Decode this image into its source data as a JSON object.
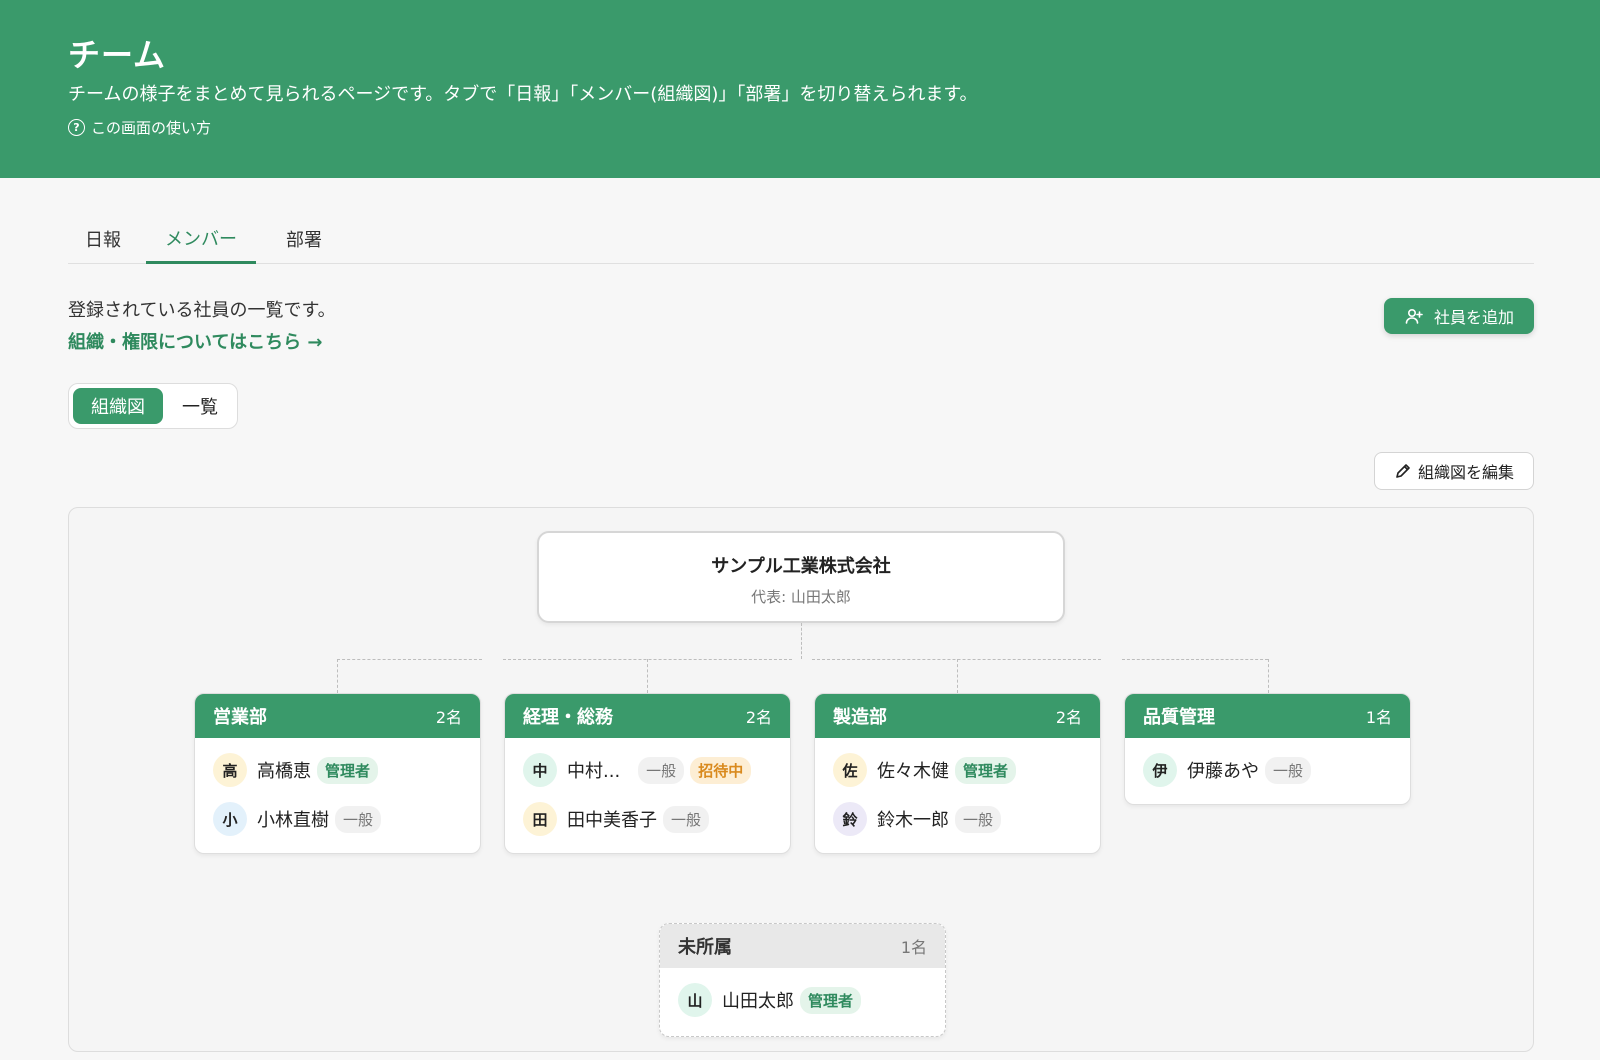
{
  "header": {
    "title": "チーム",
    "description": "チームの様子をまとめて見られるページです。タブで「日報」「メンバー(組織図)」「部署」を切り替えられます。",
    "help_label": "この画面の使い方",
    "help_icon": "question-circle-icon"
  },
  "tabs": [
    {
      "label": "日報",
      "active": false
    },
    {
      "label": "メンバー",
      "active": true
    },
    {
      "label": "部署",
      "active": false
    }
  ],
  "members_page": {
    "intro": "登録されている社員の一覧です。",
    "org_link": "組織・権限についてはこちら →",
    "add_button": "社員を追加",
    "view_toggle": [
      "組織図",
      "一覧"
    ],
    "view_selected": "組織図",
    "edit_button": "組織図を編集"
  },
  "company": {
    "name": "サンプル工業株式会社",
    "representative": "代表: 山田太郎"
  },
  "departments": [
    {
      "name": "営業部",
      "count": "2名",
      "members": [
        {
          "initial": "高",
          "name": "高橋恵",
          "badges": [
            {
              "text": "管理者",
              "kind": "admin"
            }
          ],
          "avatar_color": "#fdf3d6"
        },
        {
          "initial": "小",
          "name": "小林直樹",
          "badges": [
            {
              "text": "一般",
              "kind": "general"
            }
          ],
          "avatar_color": "#e3f1fb"
        }
      ]
    },
    {
      "name": "経理・総務",
      "count": "2名",
      "members": [
        {
          "initial": "中",
          "name": "中村...",
          "badges": [
            {
              "text": "一般",
              "kind": "general"
            },
            {
              "text": "招待中",
              "kind": "invite"
            }
          ],
          "avatar_color": "#e0f5ec"
        },
        {
          "initial": "田",
          "name": "田中美香子",
          "badges": [
            {
              "text": "一般",
              "kind": "general"
            }
          ],
          "avatar_color": "#fdf3d6"
        }
      ]
    },
    {
      "name": "製造部",
      "count": "2名",
      "members": [
        {
          "initial": "佐",
          "name": "佐々木健",
          "badges": [
            {
              "text": "管理者",
              "kind": "admin"
            }
          ],
          "avatar_color": "#fdf3d6"
        },
        {
          "initial": "鈴",
          "name": "鈴木一郎",
          "badges": [
            {
              "text": "一般",
              "kind": "general"
            }
          ],
          "avatar_color": "#ece9f7"
        }
      ]
    },
    {
      "name": "品質管理",
      "count": "1名",
      "members": [
        {
          "initial": "伊",
          "name": "伊藤あや",
          "badges": [
            {
              "text": "一般",
              "kind": "general"
            }
          ],
          "avatar_color": "#e0f5ec"
        }
      ]
    }
  ],
  "unassigned": {
    "name": "未所属",
    "count": "1名",
    "members": [
      {
        "initial": "山",
        "name": "山田太郎",
        "badges": [
          {
            "text": "管理者",
            "kind": "admin"
          }
        ],
        "avatar_color": "#e0f5ec"
      }
    ]
  },
  "colors": {
    "brand": "#3a9a6b",
    "brand_text": "#2f8a5e"
  }
}
